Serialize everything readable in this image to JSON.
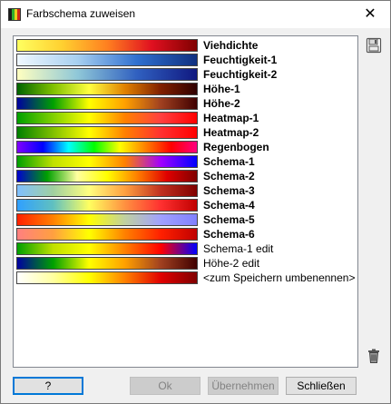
{
  "window": {
    "title": "Farbschema zuweisen",
    "close_glyph": "✕"
  },
  "schemes": [
    {
      "label": "Viehdichte",
      "bold": true,
      "gradient": [
        "#ffff60",
        "#ffd030",
        "#ff8020",
        "#e01020",
        "#800000"
      ]
    },
    {
      "label": "Feuchtigkeit-1",
      "bold": true,
      "gradient": [
        "#f0f8ff",
        "#a8d0f0",
        "#3070d0",
        "#103080"
      ]
    },
    {
      "label": "Feuchtigkeit-2",
      "bold": true,
      "gradient": [
        "#ffffc0",
        "#90c8d8",
        "#3060c0",
        "#101880"
      ]
    },
    {
      "label": "Höhe-1",
      "bold": true,
      "gradient": [
        "#006400",
        "#80c000",
        "#ffff40",
        "#e08000",
        "#802000",
        "#300000"
      ]
    },
    {
      "label": "Höhe-2",
      "bold": true,
      "gradient": [
        "#0000a0",
        "#00a000",
        "#ffff00",
        "#ffa000",
        "#a04020",
        "#400000"
      ]
    },
    {
      "label": "Heatmap-1",
      "bold": true,
      "gradient": [
        "#00a000",
        "#80d000",
        "#ffff00",
        "#ff8000",
        "#ff4040",
        "#ff0000"
      ]
    },
    {
      "label": "Heatmap-2",
      "bold": true,
      "gradient": [
        "#008000",
        "#80c000",
        "#ffff00",
        "#ff8000",
        "#ff3030",
        "#ff0000"
      ]
    },
    {
      "label": "Regenbogen",
      "bold": true,
      "gradient": [
        "#8000ff",
        "#0000ff",
        "#00ffff",
        "#00ff00",
        "#ffff00",
        "#ff8000",
        "#ff0000",
        "#ff0080"
      ]
    },
    {
      "label": "Schema-1",
      "bold": true,
      "gradient": [
        "#00a000",
        "#c0e000",
        "#ffff00",
        "#ff8000",
        "#a000ff",
        "#0000ff"
      ]
    },
    {
      "label": "Schema-2",
      "bold": true,
      "gradient": [
        "#0000d0",
        "#00a000",
        "#ffffa0",
        "#ffff00",
        "#ff8000",
        "#e00000",
        "#800000"
      ]
    },
    {
      "label": "Schema-3",
      "bold": true,
      "gradient": [
        "#80c0ff",
        "#a0d0a0",
        "#ffff80",
        "#ffa040",
        "#c03020",
        "#800000"
      ]
    },
    {
      "label": "Schema-4",
      "bold": true,
      "gradient": [
        "#30a0ff",
        "#60c0c0",
        "#ffff60",
        "#ff9040",
        "#ff3030",
        "#c00000"
      ]
    },
    {
      "label": "Schema-5",
      "bold": true,
      "gradient": [
        "#ff2000",
        "#ff8000",
        "#ffff00",
        "#c0d0a0",
        "#a0a0ff",
        "#8080ff"
      ]
    },
    {
      "label": "Schema-6",
      "bold": true,
      "gradient": [
        "#ff8080",
        "#ffa040",
        "#ffff00",
        "#ff8000",
        "#ff2000",
        "#c00000"
      ]
    },
    {
      "label": "Schema-1 edit",
      "bold": false,
      "gradient": [
        "#00a000",
        "#c0e000",
        "#ffff00",
        "#ff8000",
        "#ff0000",
        "#0000ff"
      ]
    },
    {
      "label": "Höhe-2 edit",
      "bold": false,
      "gradient": [
        "#0000a0",
        "#00a000",
        "#ffff00",
        "#ffa000",
        "#a04020",
        "#400000"
      ]
    },
    {
      "label": "<zum Speichern umbenennen>",
      "bold": false,
      "gradient": [
        "#ffffff",
        "#ffffa0",
        "#ffff00",
        "#ff8000",
        "#e00000",
        "#800000"
      ]
    }
  ],
  "buttons": {
    "help": "?",
    "ok": "Ok",
    "apply": "Übernehmen",
    "close": "Schließen"
  },
  "icons": {
    "save": "save-icon",
    "delete": "trash-icon",
    "app": "color-scheme-icon"
  }
}
